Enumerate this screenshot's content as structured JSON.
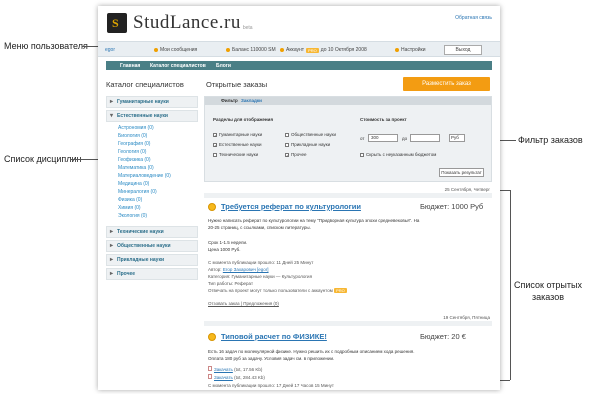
{
  "annotations": {
    "user_menu": "Меню пользователя",
    "disciplines": "Список дисциплин",
    "filter": "Фильтр заказов",
    "orders_line1": "Список отрытых",
    "orders_line2": "заказов"
  },
  "header": {
    "logo_letter": "S",
    "logo_text": "StudLance.ru",
    "logo_sub": "beta",
    "top_link": "Обратная связь"
  },
  "user_menu": {
    "user": "egor",
    "messages": "Мои сообщения",
    "balance": "Баланс 110000 SM",
    "account_label": "Аккаунт",
    "account_badge": "PRO",
    "account_until": "до 10 Октября 2008",
    "settings": "Настройки",
    "exit": "Выход"
  },
  "nav": [
    "Главная",
    "Каталог специалистов",
    "Блоги"
  ],
  "sidebar": {
    "title": "Каталог специалистов",
    "categories": [
      "Гуманитарные науки",
      "Естественные науки",
      "Технические науки",
      "Общественные науки",
      "Прикладные науки",
      "Прочее"
    ],
    "subitems": [
      "Астрономия (0)",
      "Биология (0)",
      "География (0)",
      "Геология (0)",
      "Геофизика (0)",
      "Математика (0)",
      "Материаловедение (0)",
      "Медицина (0)",
      "Минералогия (0)",
      "Физика (0)",
      "Химия (0)",
      "Экология (0)"
    ]
  },
  "main": {
    "title": "Открытые заказы",
    "post_button": "Разместить заказ"
  },
  "filter": {
    "tabs": [
      "Фильтр",
      "Закладки"
    ],
    "sections_title": "Разделы для отображения",
    "checks": [
      {
        "label": "Гуманитарные науки",
        "checked": true
      },
      {
        "label": "Естественные науки",
        "checked": true
      },
      {
        "label": "Технические науки",
        "checked": false
      },
      {
        "label": "Общественные науки",
        "checked": false
      },
      {
        "label": "Прикладные науки",
        "checked": false
      },
      {
        "label": "Прочее",
        "checked": true
      }
    ],
    "cost_title": "Стоимость за проект",
    "from_label": "от",
    "from_value": "300",
    "to_label": "до",
    "to_value": "",
    "currency": "Руб",
    "no_budget": "Скрыть с неуказанным бюджетом",
    "apply": "Показать результат"
  },
  "orders": [
    {
      "date": "25 Сентября, Четверг",
      "title": "Требуется реферат по культурологии",
      "budget": "Бюджет: 1000 Руб",
      "text1": "Нужно написать реферат по культурологии на тему \"Придворная культура эпохи средневековья\". На",
      "text2": "20-25 страниц, с ссылками, списком литературы.",
      "deadline": "Срок 1-1.5 недели.",
      "price": "Цена 1000 Руб.",
      "since": "С момента публикации прошло: 11 Дней 25 Минут",
      "author_label": "Автор:",
      "author": "Егор Захарович [egor]",
      "category": "Категория: Гуманитарные науки — Культурология",
      "type": "Тип работы: Реферат",
      "pro_note": "Отвечать на проект могут только пользователи с аккаунтом",
      "pro_badge": "PRO",
      "links": "Отзовать заказ | Предложения (0)"
    },
    {
      "date": "19 Сентября, Пятница",
      "title": "Типовой расчет по ФИЗИКЕ!",
      "budget": "Бюджет: 20 €",
      "text1": "Есть 16 задач по молекулярной физике. Нужно решить их с подробным описанием хода решения.",
      "text2": "Оплата 180 руб за задачу. Условия задач см. в приложении.",
      "file1": "Закачать",
      "file1_meta": "(txt, 17.56 Kb)",
      "file2": "Закачать",
      "file2_meta": "(txt, 284.43 Kb)",
      "since": "С момента публикации прошло: 17 Дней 17 Часов 15 Минут"
    }
  ]
}
